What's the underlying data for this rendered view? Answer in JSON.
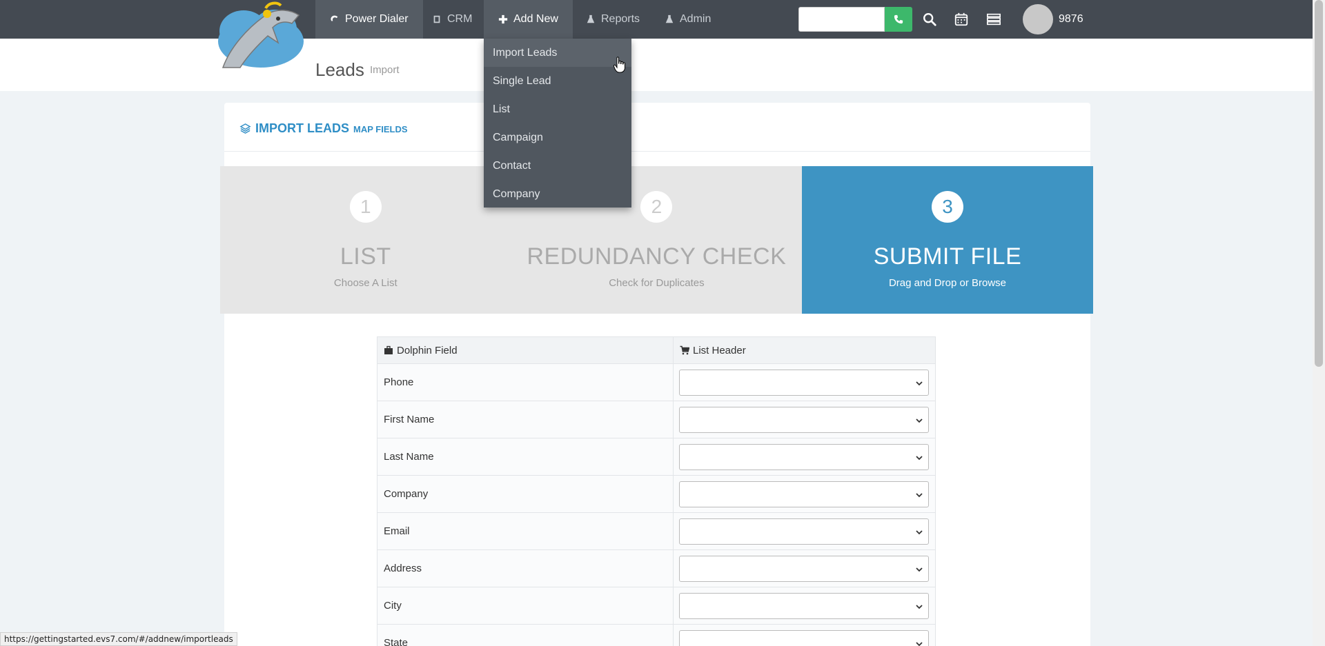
{
  "nav": {
    "items": [
      {
        "label": "Power Dialer",
        "icon": "headset-icon"
      },
      {
        "label": "CRM",
        "icon": "book-icon"
      },
      {
        "label": "Add New",
        "icon": "plus-icon"
      },
      {
        "label": "Reports",
        "icon": "flask-icon"
      },
      {
        "label": "Admin",
        "icon": "flask-icon"
      }
    ],
    "search_placeholder": "",
    "user_id": "9876"
  },
  "dropdown": {
    "items": [
      "Import Leads",
      "Single Lead",
      "List",
      "Campaign",
      "Contact",
      "Company"
    ]
  },
  "page": {
    "title": "Leads",
    "subtitle": "Import"
  },
  "card": {
    "title": "IMPORT LEADS",
    "subtitle": "MAP FIELDS"
  },
  "wizard": {
    "steps": [
      {
        "num": "1",
        "title": "LIST",
        "desc": "Choose A List",
        "active": false
      },
      {
        "num": "2",
        "title": "REDUNDANCY CHECK",
        "desc": "Check for Duplicates",
        "active": false
      },
      {
        "num": "3",
        "title": "SUBMIT FILE",
        "desc": "Drag and Drop or Browse",
        "active": true
      }
    ]
  },
  "table": {
    "headers": [
      "Dolphin Field",
      "List Header"
    ],
    "rows": [
      "Phone",
      "First Name",
      "Last Name",
      "Company",
      "Email",
      "Address",
      "City",
      "State"
    ]
  },
  "status_url": "https://gettingstarted.evs7.com/#/addnew/importleads",
  "colors": {
    "navbar": "#444a52",
    "accent_blue": "#3e94c3",
    "call_green": "#3db86b"
  }
}
